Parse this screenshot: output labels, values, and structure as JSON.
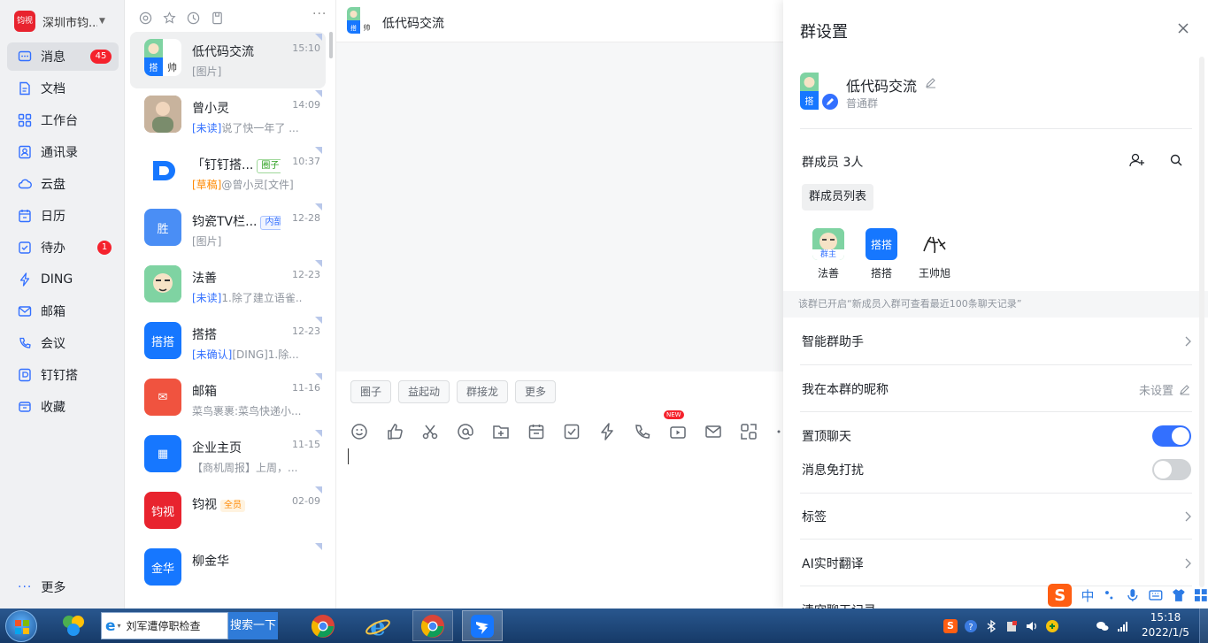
{
  "sidebar": {
    "org_name": "深圳市钧...",
    "org_logo_text": "钧视",
    "items": [
      {
        "label": "消息",
        "icon": "message-icon",
        "badge": "45"
      },
      {
        "label": "文档",
        "icon": "document-icon",
        "badge": ""
      },
      {
        "label": "工作台",
        "icon": "workbench-icon",
        "badge": ""
      },
      {
        "label": "通讯录",
        "icon": "contacts-icon",
        "badge": ""
      },
      {
        "label": "云盘",
        "icon": "cloud-icon",
        "badge": ""
      },
      {
        "label": "日历",
        "icon": "calendar-icon",
        "badge": ""
      },
      {
        "label": "待办",
        "icon": "todo-icon",
        "badge": "1"
      },
      {
        "label": "DING",
        "icon": "ding-icon",
        "badge": ""
      },
      {
        "label": "邮箱",
        "icon": "mail-icon",
        "badge": ""
      },
      {
        "label": "会议",
        "icon": "meeting-icon",
        "badge": ""
      },
      {
        "label": "钉钉搭",
        "icon": "dingda-icon",
        "badge": ""
      },
      {
        "label": "收藏",
        "icon": "favorites-icon",
        "badge": ""
      }
    ],
    "more_label": "更多"
  },
  "conversations": [
    {
      "name": "低代码交流",
      "time": "15:10",
      "preview": "[图片]",
      "tag": "",
      "tag_style": "",
      "prefix": "",
      "prefix_style": "",
      "avatar_text": "",
      "avatar_color": "#e8f3ff",
      "active": true
    },
    {
      "name": "曾小灵",
      "time": "14:09",
      "preview": "说了快一年了 ...",
      "tag": "",
      "tag_style": "",
      "prefix": "[未读]",
      "prefix_style": "blue",
      "avatar_text": "",
      "avatar_color": "#b89a84",
      "active": false
    },
    {
      "name": "「钉钉搭...",
      "time": "10:37",
      "preview": "@曾小灵[文件]",
      "tag": "圈子",
      "tag_style": "green",
      "prefix": "[草稿]",
      "prefix_style": "orange",
      "avatar_text": "D",
      "avatar_color": "#ffffff",
      "active": false
    },
    {
      "name": "钧瓷TV栏...",
      "time": "12-28",
      "preview": "[图片]",
      "tag": "内部",
      "tag_style": "blue",
      "prefix": "",
      "prefix_style": "",
      "avatar_text": "胜",
      "avatar_color": "#4a8ef5",
      "active": false
    },
    {
      "name": "法善",
      "time": "12-23",
      "preview": "1.除了建立语雀...",
      "tag": "",
      "tag_style": "",
      "prefix": "[未读]",
      "prefix_style": "blue",
      "avatar_text": "",
      "avatar_color": "#7fd3a2",
      "active": false
    },
    {
      "name": "搭搭",
      "time": "12-23",
      "preview": "[DING]1.除...",
      "tag": "",
      "tag_style": "",
      "prefix": "[未确认]",
      "prefix_style": "blue",
      "avatar_text": "搭搭",
      "avatar_color": "#1677ff",
      "active": false
    },
    {
      "name": "邮箱",
      "time": "11-16",
      "preview": "菜鸟裹裹:菜鸟快递小...",
      "tag": "",
      "tag_style": "",
      "prefix": "",
      "prefix_style": "",
      "avatar_text": "✉",
      "avatar_color": "#f0533f",
      "active": false
    },
    {
      "name": "企业主页",
      "time": "11-15",
      "preview": "【商机周报】上周，...",
      "tag": "",
      "tag_style": "",
      "prefix": "",
      "prefix_style": "",
      "avatar_text": "▦",
      "avatar_color": "#1677ff",
      "active": false
    },
    {
      "name": "钧视",
      "time": "02-09",
      "preview": "",
      "tag": "全员",
      "tag_style": "orange",
      "prefix": "",
      "prefix_style": "",
      "avatar_text": "钧视",
      "avatar_color": "#e8232e",
      "active": false
    },
    {
      "name": "柳金华",
      "time": "",
      "preview": "",
      "tag": "",
      "tag_style": "",
      "prefix": "",
      "prefix_style": "",
      "avatar_text": "金华",
      "avatar_color": "#1677ff",
      "active": false
    }
  ],
  "chat": {
    "title": "低代码交流",
    "quick_buttons": [
      "圈子",
      "益起动",
      "群接龙",
      "更多"
    ],
    "toolbar_icons": [
      "emoji-icon",
      "thumbs-up-icon",
      "scissors-icon",
      "at-icon",
      "folder-plus-icon",
      "calendar-icon",
      "checkbox-icon",
      "lightning-icon",
      "call-icon",
      "live-icon",
      "mail-icon",
      "screenshot-icon",
      "more-icon"
    ],
    "new_badge": "NEW"
  },
  "settings": {
    "title": "群设置",
    "group_name": "低代码交流",
    "group_type": "普通群",
    "members_label": "群成员 3人",
    "members_list_button": "群成员列表",
    "members": [
      {
        "name": "法善",
        "owner_tag": "群主",
        "avatar_text": "",
        "avatar_color": "#7fd3a2"
      },
      {
        "name": "搭搭",
        "owner_tag": "",
        "avatar_text": "搭搭",
        "avatar_color": "#1677ff"
      },
      {
        "name": "王帅旭",
        "owner_tag": "",
        "avatar_text": "",
        "avatar_color": "#ffffff"
      }
    ],
    "notice": "该群已开启“新成员入群可查看最近100条聊天记录”",
    "rows": {
      "assistant": "智能群助手",
      "nickname": "我在本群的昵称",
      "nickname_value": "未设置",
      "pin": "置顶聊天",
      "pin_on": true,
      "mute": "消息免打扰",
      "mute_on": false,
      "tags": "标签",
      "translate": "AI实时翻译",
      "history": "清空聊天记录"
    }
  },
  "ime": {
    "s_label": "S",
    "lang": "中"
  },
  "taskbar": {
    "search_text": "刘军遭停职检查",
    "search_button": "搜索一下",
    "time": "15:18",
    "date": "2022/1/5"
  },
  "colors": {
    "accent": "#3370ff",
    "badge_red": "#f5222d",
    "brand_red": "#e8232e"
  }
}
